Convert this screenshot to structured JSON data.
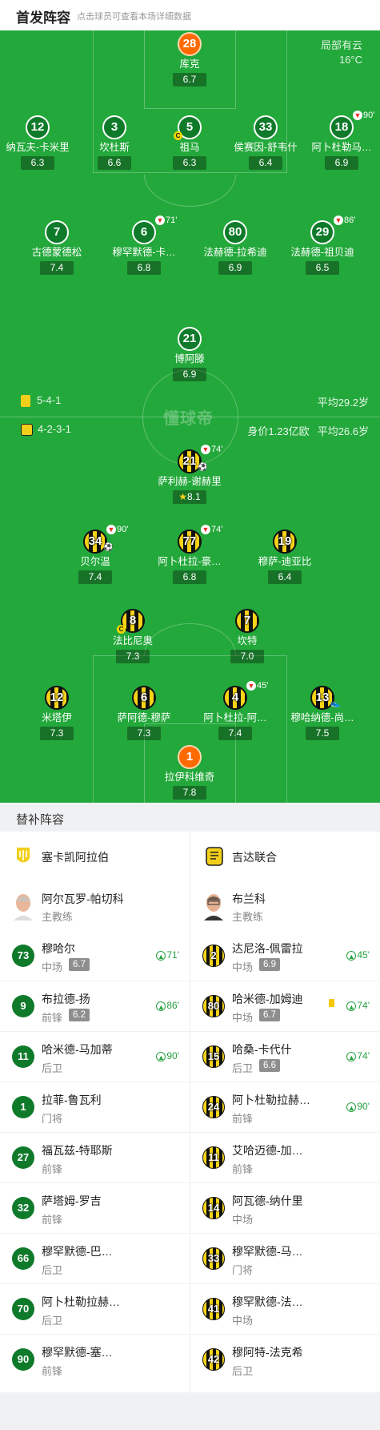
{
  "header": {
    "title": "首发阵容",
    "hint": "点击球员可查看本场详细数据"
  },
  "weather": {
    "condition": "局部有云",
    "temp": "16°C"
  },
  "watermark": "懂球帝",
  "home_info": {
    "formation": "5-4-1",
    "avg_age": "平均29.2岁"
  },
  "away_info": {
    "formation": "4-2-3-1",
    "value": "身价1.23亿欧",
    "avg_age": "平均26.6岁"
  },
  "home_players": [
    {
      "num": "28",
      "name": "库克",
      "rating": "6.7"
    },
    {
      "num": "12",
      "name": "纳瓦夫-卡米里",
      "rating": "6.3"
    },
    {
      "num": "3",
      "name": "坎杜斯",
      "rating": "6.6"
    },
    {
      "num": "5",
      "name": "祖马",
      "rating": "6.3",
      "cap": "C"
    },
    {
      "num": "33",
      "name": "侯赛因-舒韦什",
      "rating": "6.4"
    },
    {
      "num": "18",
      "name": "阿卜杜勒马…",
      "rating": "6.9",
      "sub": "90'"
    },
    {
      "num": "7",
      "name": "古德蒙德松",
      "rating": "7.4"
    },
    {
      "num": "6",
      "name": "穆罕默德-卡…",
      "rating": "6.8",
      "sub": "71'"
    },
    {
      "num": "80",
      "name": "法赫德-拉希迪",
      "rating": "6.9"
    },
    {
      "num": "29",
      "name": "法赫德-祖贝迪",
      "rating": "6.5",
      "sub": "86'"
    },
    {
      "num": "21",
      "name": "博阿滕",
      "rating": "6.9"
    }
  ],
  "away_players": [
    {
      "num": "21",
      "name": "萨利赫-谢赫里",
      "rating": "8.1",
      "sub": "74'"
    },
    {
      "num": "34",
      "name": "贝尔温",
      "rating": "7.4",
      "sub": "90'"
    },
    {
      "num": "77",
      "name": "阿卜杜拉-豪…",
      "rating": "6.8",
      "sub": "74'"
    },
    {
      "num": "19",
      "name": "穆萨-迪亚比",
      "rating": "6.4"
    },
    {
      "num": "8",
      "name": "法比尼奥",
      "rating": "7.3",
      "cap": "C"
    },
    {
      "num": "7",
      "name": "坎特",
      "rating": "7.0"
    },
    {
      "num": "12",
      "name": "米塔伊",
      "rating": "7.3"
    },
    {
      "num": "6",
      "name": "萨阿德-穆萨",
      "rating": "7.3"
    },
    {
      "num": "4",
      "name": "阿卜杜拉-阿…",
      "rating": "7.4",
      "sub": "45'"
    },
    {
      "num": "13",
      "name": "穆哈纳德-尚…",
      "rating": "7.5"
    },
    {
      "num": "1",
      "name": "拉伊科维奇",
      "rating": "7.8"
    }
  ],
  "subs_title": "替补阵容",
  "home_subs": {
    "team": "塞卡凯阿拉伯",
    "coach": {
      "name": "阿尔瓦罗-帕切科",
      "role": "主教练"
    },
    "players": [
      {
        "num": "73",
        "name": "穆哈尔",
        "pos": "中场",
        "rating": "6.7",
        "in": "71'"
      },
      {
        "num": "9",
        "name": "布拉德-扬",
        "pos": "前锋",
        "rating": "6.2",
        "in": "86'"
      },
      {
        "num": "11",
        "name": "哈米德-马加蒂",
        "pos": "后卫",
        "in": "90'"
      },
      {
        "num": "1",
        "name": "拉菲-鲁瓦利",
        "pos": "门将"
      },
      {
        "num": "27",
        "name": "福瓦兹-特耶斯",
        "pos": "前锋"
      },
      {
        "num": "32",
        "name": "萨塔姆-罗吉",
        "pos": "前锋"
      },
      {
        "num": "66",
        "name": "穆罕默德-巴…",
        "pos": "后卫"
      },
      {
        "num": "70",
        "name": "阿卜杜勒拉赫…",
        "pos": "后卫"
      },
      {
        "num": "90",
        "name": "穆罕默德-塞…",
        "pos": "前锋"
      }
    ]
  },
  "away_subs": {
    "team": "吉达联合",
    "coach": {
      "name": "布兰科",
      "role": "主教练"
    },
    "players": [
      {
        "num": "2",
        "name": "达尼洛-佩雷拉",
        "pos": "中场",
        "rating": "6.9",
        "in": "45'"
      },
      {
        "num": "80",
        "name": "哈米德-加姆迪",
        "pos": "中场",
        "rating": "6.7",
        "in": "74'",
        "yellow": true
      },
      {
        "num": "15",
        "name": "哈桑-卡代什",
        "pos": "后卫",
        "rating": "6.6",
        "in": "74'"
      },
      {
        "num": "24",
        "name": "阿卜杜勒拉赫…",
        "pos": "前锋",
        "in": "90'"
      },
      {
        "num": "11",
        "name": "艾哈迈德-加…",
        "pos": "前锋"
      },
      {
        "num": "14",
        "name": "阿瓦德-纳什里",
        "pos": "中场"
      },
      {
        "num": "33",
        "name": "穆罕默德-马…",
        "pos": "门将"
      },
      {
        "num": "41",
        "name": "穆罕默德-法…",
        "pos": "中场"
      },
      {
        "num": "42",
        "name": "穆阿特-法克希",
        "pos": "后卫"
      }
    ]
  }
}
